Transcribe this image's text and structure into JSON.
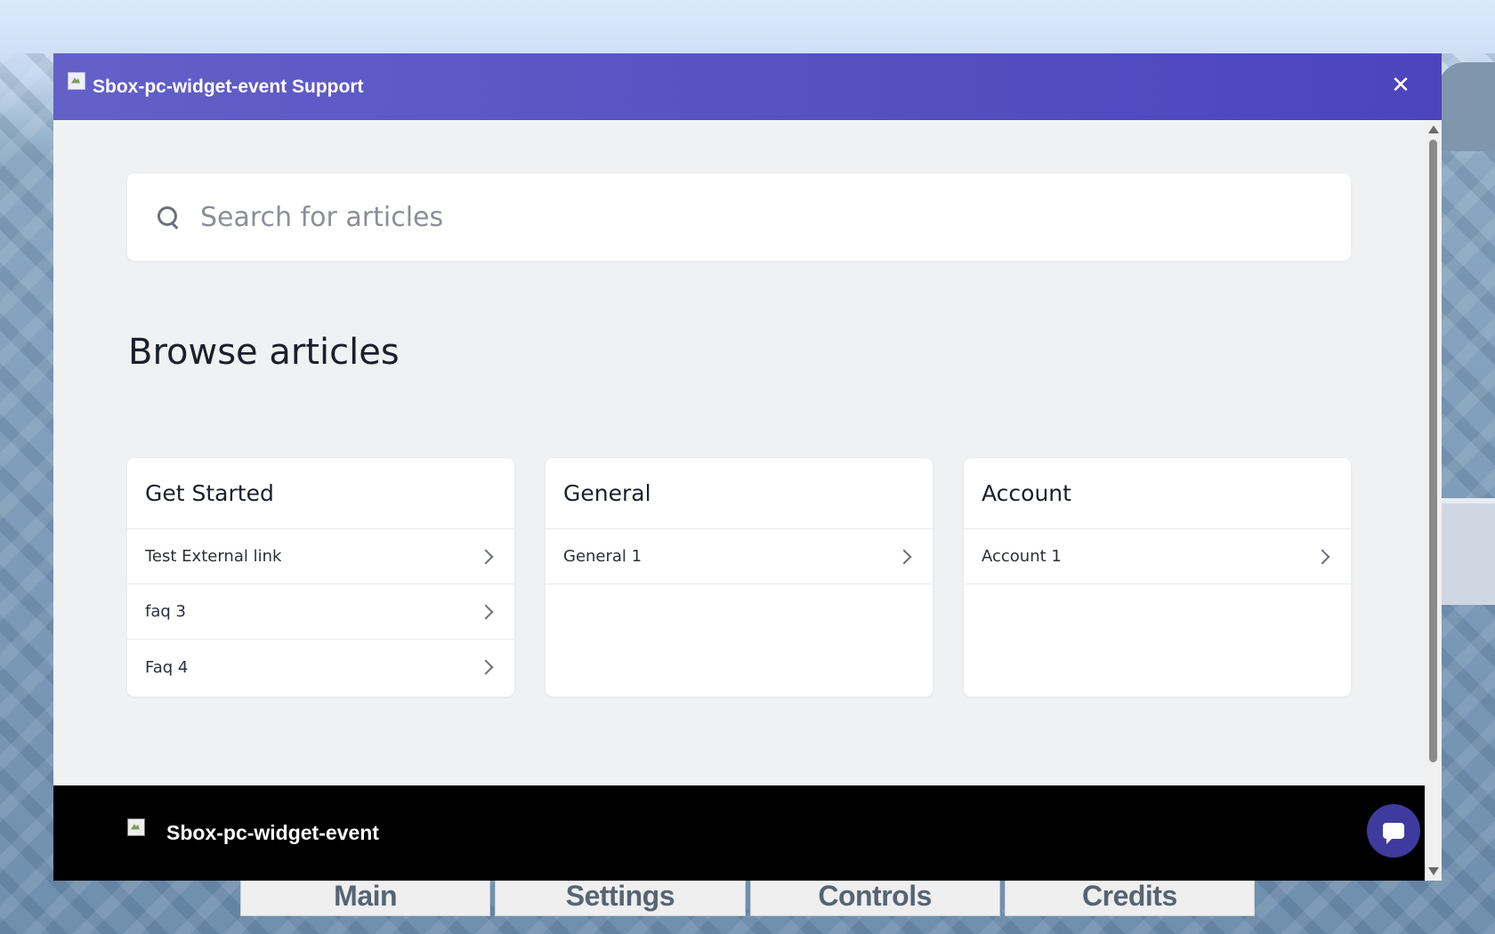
{
  "widget": {
    "header_title": "Sbox-pc-widget-event Support",
    "close_symbol": "✕",
    "colors": {
      "header_start": "#6360c8",
      "header_end": "#4c44bd",
      "chat_button": "#3f3a9e"
    }
  },
  "search": {
    "placeholder": "Search for articles",
    "icon": "search-icon"
  },
  "browse": {
    "title": "Browse articles",
    "cards": [
      {
        "title": "Get Started",
        "items": [
          "Test External link",
          "faq 3",
          "Faq 4"
        ]
      },
      {
        "title": "General",
        "items": [
          "General 1"
        ]
      },
      {
        "title": "Account",
        "items": [
          "Account 1"
        ]
      }
    ]
  },
  "footer": {
    "title": "Sbox-pc-widget-event"
  },
  "game_menu": {
    "tabs": [
      "Main",
      "Settings",
      "Controls",
      "Credits"
    ]
  }
}
